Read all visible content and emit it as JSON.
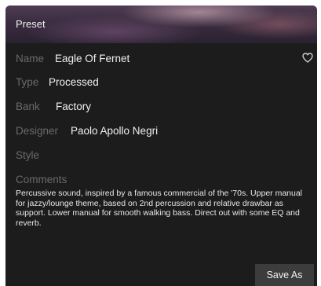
{
  "header": {
    "title": "Preset"
  },
  "fields": {
    "name": {
      "label": "Name",
      "value": "Eagle Of Fernet"
    },
    "type": {
      "label": "Type",
      "value": "Processed"
    },
    "bank": {
      "label": "Bank",
      "value": "Factory"
    },
    "designer": {
      "label": "Designer",
      "value": "Paolo Apollo Negri"
    },
    "style": {
      "label": "Style",
      "value": ""
    },
    "comments": {
      "label": "Comments",
      "value": "Percussive sound, inspired by a famous commercial of the '70s. Upper manual for jazzy/lounge theme, based on 2nd percussion and relative drawbar as support. Lower manual for smooth walking bass. Direct out with some EQ and reverb."
    }
  },
  "favorite_icon": "heart-outline-icon",
  "actions": {
    "save_as_label": "Save As"
  },
  "colors": {
    "panel_bg": "#1c1c1c",
    "label": "#6a6a6a",
    "value": "#f0f0f0",
    "button_bg": "#3c3c3c"
  }
}
